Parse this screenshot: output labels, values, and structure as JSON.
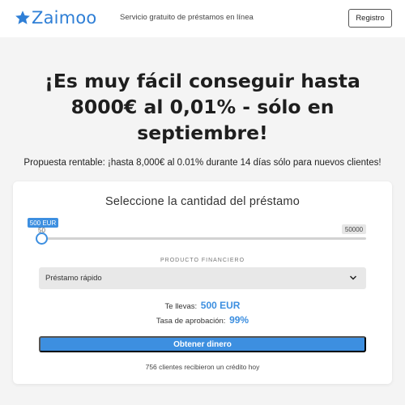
{
  "header": {
    "brand": "Zaimoo",
    "logo_icon": "star-icon",
    "tagline": "Servicio gratuito de préstamos en línea",
    "register_label": "Registro"
  },
  "hero": {
    "title": "¡Es muy fácil conseguir hasta 8000€ al 0,01% - sólo en septiembre!",
    "subtitle": "Propuesta rentable: ¡hasta 8,000€ al 0.01% durante 14 días sólo para nuevos clientes!"
  },
  "calculator": {
    "title": "Seleccione la cantidad del préstamo",
    "slider": {
      "current_label": "500 EUR",
      "min_label": "50",
      "max_label": "50000",
      "value": 500,
      "min": 50,
      "max": 50000
    },
    "product_label": "PRODUCTO FINANCIERO",
    "product_selected": "Préstamo rápido",
    "product_icon": "chevron-down-icon",
    "receive_label": "Te llevas:",
    "receive_value": "500 EUR",
    "approval_label": "Tasa de aprobación:",
    "approval_value": "99%",
    "cta_label": "Obtener dinero",
    "clients_note": "756 clientes recibieron un crédito hoy"
  },
  "colors": {
    "accent": "#3d8fe0",
    "brand": "#2f7fd6",
    "background": "#f4f4f4"
  }
}
